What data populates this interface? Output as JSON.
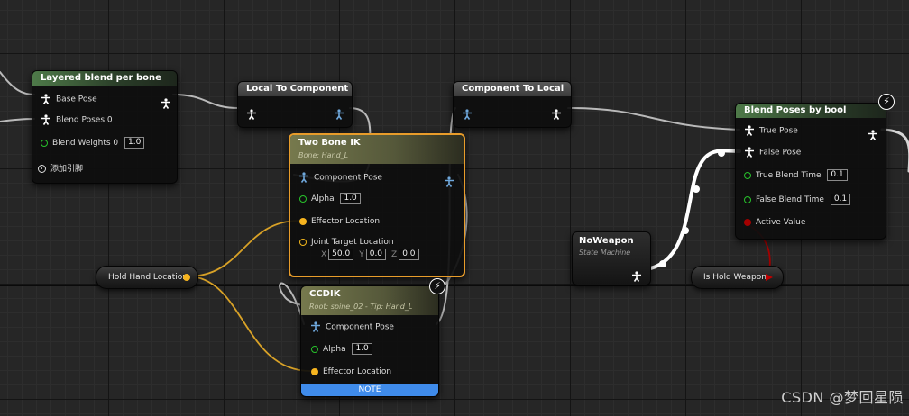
{
  "colors": {
    "pose_pin": "#ffffff",
    "local_pose_pin": "#6fa8dc",
    "float_pin": "#27c22b",
    "vector_pin": "#f6b41f",
    "bool_pin": "#a40000",
    "note_bar": "#3f8bea",
    "ik_selected_border": "#e89c2a"
  },
  "nodes": {
    "layered_blend": {
      "title": "Layered blend per bone",
      "base_pose": "Base Pose",
      "blend_poses": "Blend Poses 0",
      "blend_weights": "Blend Weights 0",
      "blend_weights_value": "1.0",
      "add_pin": "添加引脚"
    },
    "local_to_component": {
      "title": "Local To Component"
    },
    "component_to_local": {
      "title": "Component To Local"
    },
    "two_bone_ik": {
      "title": "Two Bone IK",
      "subtitle": "Bone: Hand_L",
      "component_pose": "Component Pose",
      "alpha": "Alpha",
      "alpha_value": "1.0",
      "effector_location": "Effector Location",
      "joint_target_location": "Joint Target Location",
      "x_label": "X",
      "x_value": "50.0",
      "y_label": "Y",
      "y_value": "0.0",
      "z_label": "Z",
      "z_value": "0.0"
    },
    "ccdik": {
      "title": "CCDIK",
      "subtitle": "Root: spine_02 - Tip: Hand_L",
      "component_pose": "Component Pose",
      "alpha": "Alpha",
      "alpha_value": "1.0",
      "effector_location": "Effector Location",
      "note": "NOTE"
    },
    "blend_poses_by_bool": {
      "title": "Blend Poses by bool",
      "true_pose": "True Pose",
      "false_pose": "False Pose",
      "true_blend_time": "True Blend Time",
      "true_blend_time_value": "0.1",
      "false_blend_time": "False Blend Time",
      "false_blend_time_value": "0.1",
      "active_value": "Active Value"
    },
    "no_weapon": {
      "title": "NoWeapon",
      "subtitle": "State Machine"
    },
    "hold_hand_location": {
      "label": "Hold Hand Location"
    },
    "is_hold_weapon": {
      "label": "Is Hold Weapon"
    }
  },
  "watermark": "CSDN @梦回星陨"
}
